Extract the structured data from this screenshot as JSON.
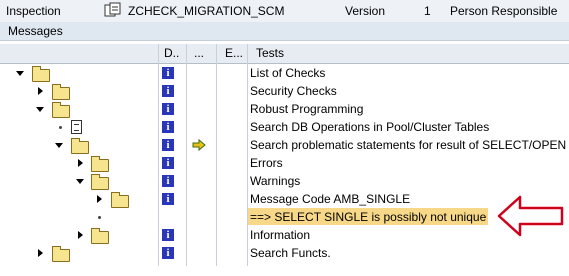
{
  "topbar": {
    "inspection_label": "Inspection",
    "object_name": "ZCHECK_MIGRATION_SCM",
    "version_label": "Version",
    "version_value": "1",
    "person_label": "Person Responsible"
  },
  "messages_title": "Messages",
  "columns": [
    "D..",
    "...",
    "E...",
    "Tests"
  ],
  "rows": [
    {
      "label": "List of Checks"
    },
    {
      "label": "Security Checks"
    },
    {
      "label": "Robust Programming"
    },
    {
      "label": "Search DB Operations in Pool/Cluster Tables"
    },
    {
      "label": "Search problematic statements for result of SELECT/OPEN"
    },
    {
      "label": "Errors"
    },
    {
      "label": "Warnings"
    },
    {
      "label": "Message Code AMB_SINGLE"
    },
    {
      "label": "==> SELECT SINGLE is possibly not unique"
    },
    {
      "label": "Information"
    },
    {
      "label": "Search Functs."
    }
  ],
  "icons": {
    "info": "i",
    "highlight_color": "#f7d888",
    "arrow_color": "#d0021b"
  }
}
